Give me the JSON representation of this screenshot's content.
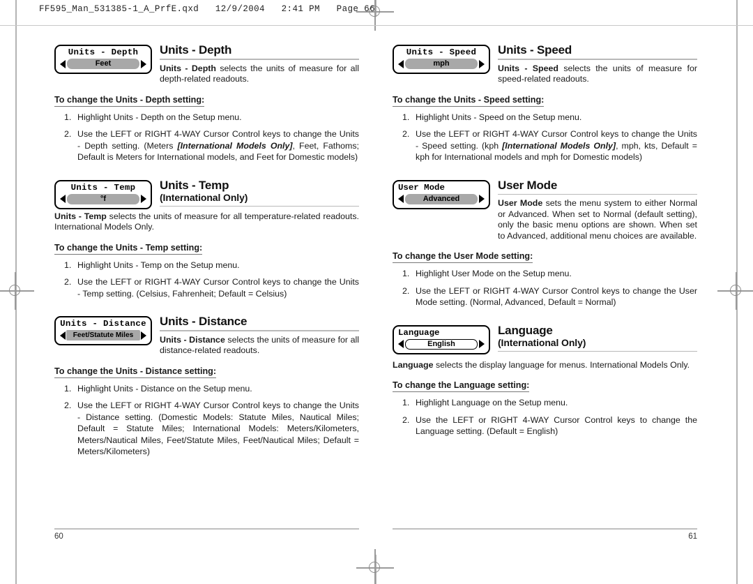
{
  "header": {
    "line": "FF595_Man_531385-1_A_PrfE.qxd   12/9/2004   2:41 PM   Page 66"
  },
  "left_column": {
    "page_number": "60",
    "sections": [
      {
        "widget": {
          "title": "Units - Depth",
          "value": "Feet",
          "left_arrow": "left-arrow-icon",
          "right_arrow": "right-arrow-icon"
        },
        "title": "Units - Depth",
        "subtitle": "",
        "intro_bold": "Units - Depth",
        "intro_rest": " selects the units of measure for all depth-related readouts.",
        "howto": "To change the Units - Depth setting:",
        "steps": [
          {
            "num": "1.",
            "text": "Highlight Units - Depth on the Setup menu."
          },
          {
            "num": "2.",
            "pre": "Use the LEFT or RIGHT 4-WAY Cursor Control keys to change the Units - Depth setting. (Meters ",
            "italic": "[International Models Only]",
            "post": ", Feet, Fathoms; Default is Meters for International models, and Feet for Domestic models)"
          }
        ]
      },
      {
        "widget": {
          "title": "Units - Temp",
          "value": "°f",
          "left_arrow": "left-arrow-icon",
          "right_arrow": "right-arrow-icon"
        },
        "title": "Units - Temp",
        "subtitle": "(International Only)",
        "intro_bold": "Units - Temp",
        "intro_rest": " selects the units of measure for all temperature-related readouts.  International Models Only.",
        "howto": "To change the Units - Temp setting:",
        "steps": [
          {
            "num": "1.",
            "text": "Highlight Units - Temp on the Setup menu."
          },
          {
            "num": "2.",
            "pre": "Use the LEFT or RIGHT 4-WAY Cursor Control keys to change the Units - Temp setting. (Celsius, Fahrenheit; Default = Celsius)",
            "italic": "",
            "post": ""
          }
        ]
      },
      {
        "widget": {
          "title": "Units - Distance",
          "value": "Feet/Statute Miles",
          "left_arrow": "left-arrow-icon",
          "right_arrow": "right-arrow-icon"
        },
        "title": "Units - Distance",
        "subtitle": "",
        "intro_bold": "Units - Distance",
        "intro_rest": " selects the units of measure for all distance-related readouts.",
        "howto": "To change the Units - Distance setting:",
        "steps": [
          {
            "num": "1.",
            "text": "Highlight Units - Distance on the Setup menu."
          },
          {
            "num": "2.",
            "pre": "Use the LEFT or RIGHT 4-WAY Cursor Control keys to change the Units - Distance setting. (Domestic Models: Statute Miles, Nautical Miles; Default = Statute Miles; International Models: Meters/Kilometers, Meters/Nautical Miles, Feet/Statute Miles, Feet/Nautical Miles; Default = Meters/Kilometers)",
            "italic": "",
            "post": ""
          }
        ]
      }
    ]
  },
  "right_column": {
    "page_number": "61",
    "sections": [
      {
        "widget": {
          "title": "Units - Speed",
          "value": "mph",
          "left_arrow": "left-arrow-icon",
          "right_arrow": "right-arrow-icon"
        },
        "title": "Units - Speed",
        "subtitle": "",
        "intro_bold": "Units - Speed",
        "intro_rest": " selects the units of measure for speed-related readouts.",
        "howto": "To change the Units - Speed setting:",
        "steps": [
          {
            "num": "1.",
            "text": "Highlight Units - Speed on the Setup menu."
          },
          {
            "num": "2.",
            "pre": "Use the LEFT or RIGHT 4-WAY Cursor Control keys to change the Units - Speed setting. (kph ",
            "italic": "[International Models Only]",
            "post": ", mph, kts, Default = kph for International models and mph for Domestic models)"
          }
        ]
      },
      {
        "widget": {
          "title": "User Mode",
          "value": "Advanced",
          "left_arrow": "left-arrow-icon",
          "right_arrow": "right-arrow-icon"
        },
        "title": "User Mode",
        "subtitle": "",
        "intro_bold": "User Mode",
        "intro_rest": " sets the menu system to either Normal or Advanced. When set to Normal (default setting), only the basic menu options are shown.  When set to Advanced, additional menu choices are available.",
        "howto": "To change the User Mode setting:",
        "steps": [
          {
            "num": "1.",
            "text": "Highlight User Mode on the Setup menu."
          },
          {
            "num": "2.",
            "pre": "Use the LEFT or RIGHT 4-WAY Cursor Control keys to change the User Mode setting. (Normal, Advanced, Default = Normal)",
            "italic": "",
            "post": ""
          }
        ]
      },
      {
        "widget": {
          "title": "Language",
          "value": "English",
          "left_arrow": "left-arrow-icon",
          "right_arrow": "right-arrow-icon"
        },
        "title": "Language",
        "subtitle": "(International Only)",
        "intro_bold": "Language",
        "intro_rest": " selects the display language for menus. International Models Only.",
        "howto": "To change the Language setting:",
        "steps": [
          {
            "num": "1.",
            "text": "Highlight Language on the Setup menu."
          },
          {
            "num": "2.",
            "pre": "Use the LEFT or RIGHT 4-WAY Cursor Control keys to change the Language setting. (Default = English)",
            "italic": "",
            "post": ""
          }
        ]
      }
    ]
  }
}
